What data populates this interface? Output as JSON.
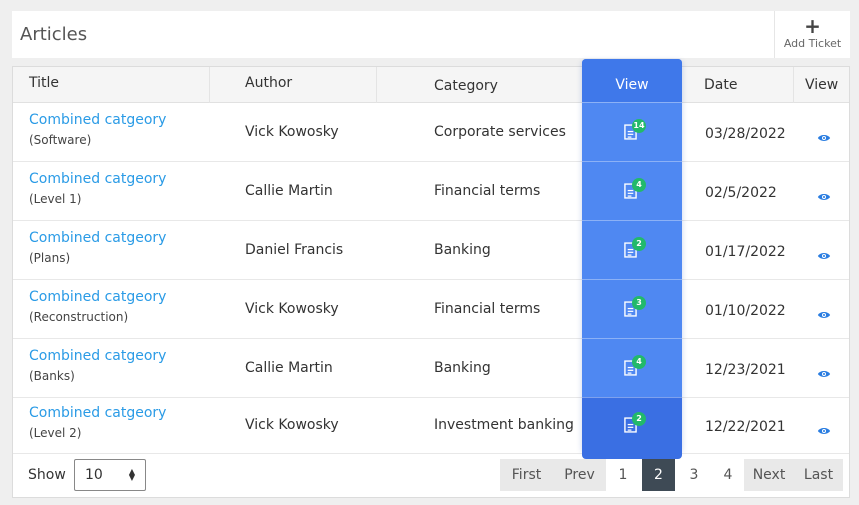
{
  "header": {
    "title": "Articles",
    "add_ticket_label": "Add Ticket",
    "add_icon": "plus-icon"
  },
  "columns": {
    "title": "Title",
    "author": "Author",
    "category": "Category",
    "view_highlight": "View",
    "date": "Date",
    "view": "View"
  },
  "rows": [
    {
      "title": "Combined catgeory",
      "subtitle": "(Software)",
      "author": "Vick Kowosky",
      "category": "Corporate services",
      "count": "14",
      "date": "03/28/2022"
    },
    {
      "title": "Combined catgeory",
      "subtitle": "(Level 1)",
      "author": "Callie Martin",
      "category": "Financial terms",
      "count": "4",
      "date": "02/5/2022"
    },
    {
      "title": "Combined catgeory",
      "subtitle": "(Plans)",
      "author": "Daniel Francis",
      "category": "Banking",
      "count": "2",
      "date": "01/17/2022"
    },
    {
      "title": "Combined catgeory",
      "subtitle": "(Reconstruction)",
      "author": "Vick Kowosky",
      "category": "Financial terms",
      "count": "3",
      "date": "01/10/2022"
    },
    {
      "title": "Combined catgeory",
      "subtitle": "(Banks)",
      "author": "Callie Martin",
      "category": "Banking",
      "count": "4",
      "date": "12/23/2021"
    },
    {
      "title": "Combined catgeory",
      "subtitle": "(Level 2)",
      "author": "Vick Kowosky",
      "category": "Investment banking",
      "count": "2",
      "date": "12/22/2021"
    }
  ],
  "footer": {
    "show_label": "Show",
    "page_size": "10",
    "pagination": {
      "first": "First",
      "prev": "Prev",
      "pages": [
        "1",
        "2",
        "3",
        "4"
      ],
      "active_page": "2",
      "next": "Next",
      "last": "Last"
    }
  },
  "colors": {
    "accent": "#4f88f2",
    "link": "#2a9be6",
    "badge": "#22b96a",
    "active_page": "#3e4a55"
  }
}
